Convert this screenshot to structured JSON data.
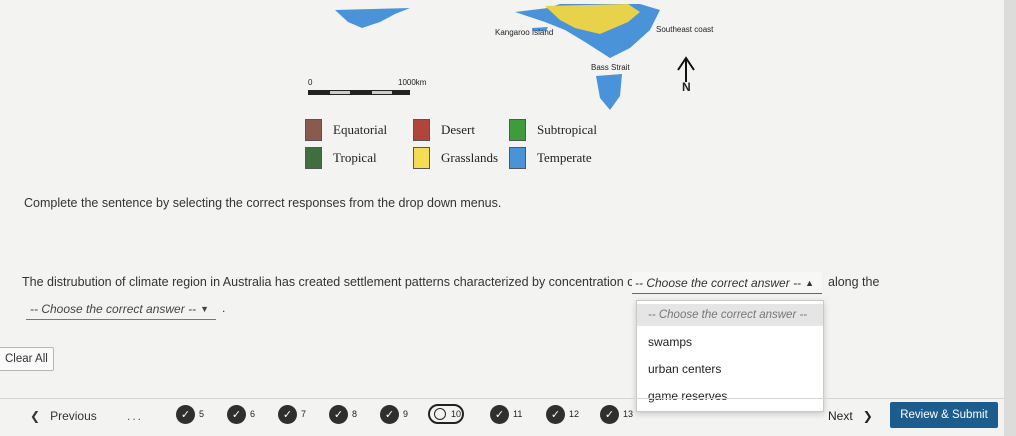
{
  "map": {
    "label_kangaroo": "Kangaroo Island",
    "label_southeast": "Southeast coast",
    "label_bass": "Bass Strait",
    "scale_start": "0",
    "scale_end": "1000km",
    "north_label": "N"
  },
  "legend": [
    {
      "label": "Equatorial",
      "color": "#8a5a4e"
    },
    {
      "label": "Desert",
      "color": "#b0463b"
    },
    {
      "label": "Subtropical",
      "color": "#3f9b3c"
    },
    {
      "label": "Tropical",
      "color": "#3e6f3c"
    },
    {
      "label": "Grasslands",
      "color": "#f2dd55"
    },
    {
      "label": "Temperate",
      "color": "#4b93d8"
    }
  ],
  "question": {
    "instruction": "Complete the sentence by selecting the correct responses from the drop down menus.",
    "sentence_part1": "The distrubution of climate region in Australia has created settlement patterns characterized by concentration of",
    "sentence_part2": "along the",
    "sentence_end": "."
  },
  "dropdown1": {
    "selected": "-- Choose the correct answer --",
    "options": [
      "-- Choose the correct answer --",
      "swamps",
      "urban centers",
      "game reserves"
    ]
  },
  "dropdown2": {
    "selected": "-- Choose the correct answer --"
  },
  "buttons": {
    "clear": "Clear All",
    "previous": "Previous",
    "next": "Next",
    "submit": "Review & Submit"
  },
  "nav": {
    "ellipsis": "...",
    "answered": [
      "5",
      "6",
      "7",
      "8",
      "9",
      "11",
      "12",
      "13"
    ],
    "current": "10"
  }
}
